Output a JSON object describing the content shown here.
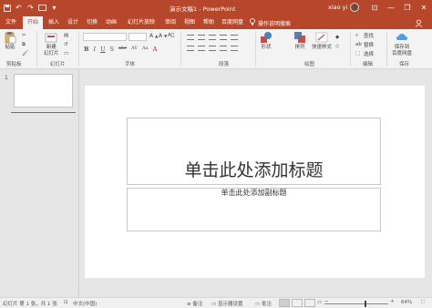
{
  "titlebar": {
    "title": "演示文稿1 - PowerPoint",
    "user": "xiao yi",
    "qat": [
      "save-icon",
      "undo-icon",
      "redo-icon",
      "start-from-beginning-icon",
      "customize-icon"
    ],
    "window_buttons": [
      "—",
      "❐",
      "✕"
    ]
  },
  "tabs": {
    "items": [
      "文件",
      "开始",
      "插入",
      "设计",
      "切换",
      "动画",
      "幻灯片放映",
      "审阅",
      "视图",
      "帮助",
      "百度网盘"
    ],
    "active": "开始",
    "tellme": "操作说明搜索"
  },
  "ribbon": {
    "clipboard": {
      "paste": "粘贴",
      "label": "剪贴板"
    },
    "slides": {
      "new_slide": "新建",
      "new_slide_2": "幻灯片",
      "label": "幻灯片"
    },
    "font": {
      "label": "字体",
      "buttons": [
        "B",
        "I",
        "U",
        "S",
        "abc",
        "AV",
        "Aa"
      ]
    },
    "paragraph": {
      "label": "段落"
    },
    "drawing": {
      "shapes": "形状",
      "arrange": "排列",
      "quick_styles": "快速样式",
      "label": "绘图"
    },
    "editing": {
      "find": "查找",
      "replace": "替换",
      "select": "选择",
      "label": "编辑"
    },
    "save": {
      "line1": "保存到",
      "line2": "百度网盘",
      "label": "保存"
    }
  },
  "thumbpane": {
    "slide_number": "1"
  },
  "slide": {
    "title_placeholder": "单击此处添加标题",
    "subtitle_placeholder": "单击此处添加副标题"
  },
  "statusbar": {
    "slide_info": "幻灯片 第 1 张，共 1 张",
    "language": "中文(中国)",
    "notes": "备注",
    "display_settings": "显示器设置",
    "comments": "批注",
    "zoom": "64%"
  },
  "colors": {
    "accent": "#b7472a",
    "ribbon_bg": "#f3f3f3",
    "workspace": "#e6e6e6"
  }
}
